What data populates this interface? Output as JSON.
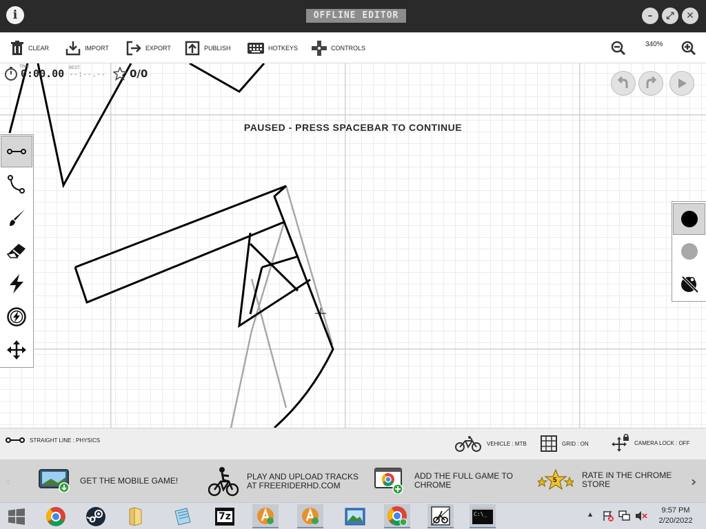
{
  "window": {
    "title": "OFFLINE EDITOR",
    "info_glyph": "i",
    "minimize_glyph": "–",
    "maximize_glyph": "⤢",
    "close_glyph": "✕"
  },
  "toolbar": {
    "clear": "CLEAR",
    "import": "IMPORT",
    "export": "EXPORT",
    "publish": "PUBLISH",
    "hotkeys": "HOTKEYS",
    "controls": "CONTROLS",
    "zoom_level": "340%"
  },
  "hud": {
    "time_label": "TIME",
    "time": "0:00.00",
    "best_label": "BEST:",
    "best": "--:--.--",
    "stars": "0/0",
    "paused_message": "PAUSED - PRESS SPACEBAR TO CONTINUE"
  },
  "left_tools": [
    {
      "name": "straight-line",
      "icon": "straight-line-icon",
      "active": true
    },
    {
      "name": "curve",
      "icon": "curve-icon",
      "active": false
    },
    {
      "name": "brush",
      "icon": "brush-icon",
      "active": false
    },
    {
      "name": "eraser",
      "icon": "eraser-icon",
      "active": false
    },
    {
      "name": "powerup",
      "icon": "lightning-icon",
      "active": false
    },
    {
      "name": "special-powerup",
      "icon": "boost-circle-icon",
      "active": false
    },
    {
      "name": "move",
      "icon": "move-arrows-icon",
      "active": false
    }
  ],
  "right_tools": [
    {
      "name": "physics-line",
      "icon": "black-dot-icon",
      "active": true
    },
    {
      "name": "scenery-line",
      "icon": "gray-dot-icon",
      "active": false
    },
    {
      "name": "no-color",
      "icon": "no-color-icon",
      "active": false
    }
  ],
  "statusbar": {
    "tool": "STRAIGHT LINE : PHYSICS",
    "vehicle": "VEHICLE : MTB",
    "grid": "GRID : ON",
    "camera_lock": "CAMERA LOCK : OFF"
  },
  "promo": {
    "mobile": "GET THE MOBILE GAME!",
    "upload_line1": "PLAY AND UPLOAD TRACKS",
    "upload_line2": "AT FREERIDERHD.COM",
    "chrome_line1": "ADD THE FULL GAME TO",
    "chrome_line2": "CHROME",
    "rate_line1": "RATE IN THE CHROME",
    "rate_line2": "STORE",
    "rate_badge": "5",
    "prev_arrow": "‹",
    "next_arrow": "›"
  },
  "taskbar": {
    "apps": [
      "start-menu",
      "chrome",
      "steam",
      "file-explorer",
      "notepad",
      "7zip",
      "app-a",
      "app-b",
      "photos",
      "chrome-profile",
      "free-rider",
      "command-prompt"
    ],
    "cmd_text": "C:\\_",
    "zip_text": "7z",
    "time": "9:57 PM",
    "date": "2/20/2022",
    "tray_up_arrow": "▲"
  },
  "colors": {
    "titlebar": "#2a2a2a",
    "canvas_bg": "#ffffff",
    "grid_major": "#d0d0d0",
    "grid_minor": "#ececec",
    "physics_line": "#000000",
    "scenery_line": "#a8a8a8",
    "chrome_red": "#db4437",
    "chrome_green": "#0f9d58",
    "chrome_yellow": "#f4b400",
    "chrome_blue": "#4285f4"
  }
}
